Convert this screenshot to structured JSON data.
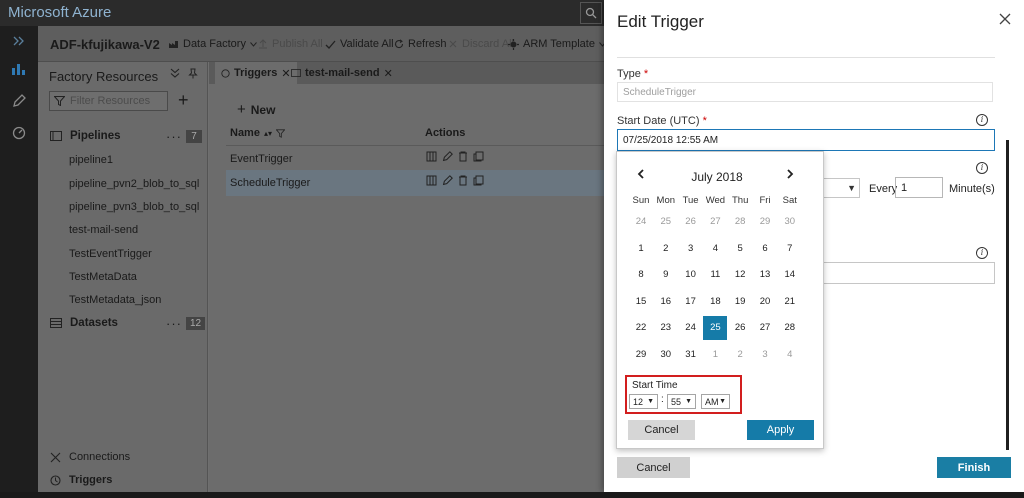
{
  "topbar": {
    "brand": "Microsoft Azure"
  },
  "subbar": {
    "factory_name": "ADF-kfujikawa-V2",
    "data_factory_label": "Data Factory",
    "publish_all_label": "Publish All",
    "validate_all_label": "Validate All",
    "refresh_label": "Refresh",
    "discard_all_label": "Discard All",
    "arm_template_label": "ARM Template"
  },
  "resources": {
    "title": "Factory Resources",
    "filter_placeholder": "Filter Resources",
    "pipelines_label": "Pipelines",
    "pipelines_count": "7",
    "pipelines": [
      "pipeline1",
      "pipeline_pvn2_blob_to_sql",
      "pipeline_pvn3_blob_to_sql",
      "test-mail-send",
      "TestEventTrigger",
      "TestMetaData",
      "TestMetadata_json"
    ],
    "datasets_label": "Datasets",
    "datasets_count": "12",
    "connections_label": "Connections",
    "triggers_label": "Triggers"
  },
  "tabs": [
    "Triggers",
    "test-mail-send"
  ],
  "canvas": {
    "new_label": "New",
    "col_name": "Name",
    "col_actions": "Actions",
    "rows": [
      "EventTrigger",
      "ScheduleTrigger"
    ]
  },
  "blade": {
    "title": "Edit Trigger",
    "type_label": "Type",
    "type_value": "ScheduleTrigger",
    "start_label": "Start Date (UTC)",
    "start_value": "07/25/2018 12:55 AM",
    "every_label": "Every",
    "every_value": "1",
    "unit_label": "Minute(s)",
    "cancel_label": "Cancel",
    "finish_label": "Finish"
  },
  "picker": {
    "month": "July 2018",
    "weekdays": [
      "Sun",
      "Mon",
      "Tue",
      "Wed",
      "Thu",
      "Fri",
      "Sat"
    ],
    "weeks": [
      [
        "24",
        "25",
        "26",
        "27",
        "28",
        "29",
        "30"
      ],
      [
        "1",
        "2",
        "3",
        "4",
        "5",
        "6",
        "7"
      ],
      [
        "8",
        "9",
        "10",
        "11",
        "12",
        "13",
        "14"
      ],
      [
        "15",
        "16",
        "17",
        "18",
        "19",
        "20",
        "21"
      ],
      [
        "22",
        "23",
        "24",
        "25",
        "26",
        "27",
        "28"
      ],
      [
        "29",
        "30",
        "31",
        "1",
        "2",
        "3",
        "4"
      ]
    ],
    "other_month": [
      [
        true,
        true,
        true,
        true,
        true,
        true,
        true
      ],
      [
        false,
        false,
        false,
        false,
        false,
        false,
        false
      ],
      [
        false,
        false,
        false,
        false,
        false,
        false,
        false
      ],
      [
        false,
        false,
        false,
        false,
        false,
        false,
        false
      ],
      [
        false,
        false,
        false,
        false,
        false,
        false,
        false
      ],
      [
        false,
        false,
        false,
        true,
        true,
        true,
        true
      ]
    ],
    "selected": "25",
    "time_label": "Start Time",
    "hour": "12",
    "minute": "55",
    "ampm": "AM",
    "cancel_label": "Cancel",
    "apply_label": "Apply",
    "highlight_color": "#d21e1e",
    "accent_color": "#157ba8"
  }
}
